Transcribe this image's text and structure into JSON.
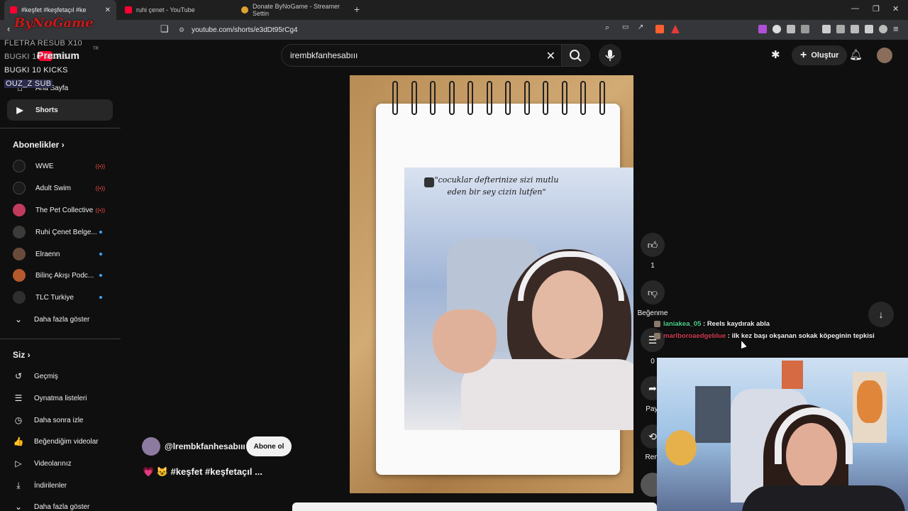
{
  "browser": {
    "tabs": [
      {
        "label": "#keşfet #keşfetaçıl #ke",
        "active": true
      },
      {
        "label": "ruhi çenet - YouTube",
        "active": false
      },
      {
        "label": "Donate ByNoGame - Streamer Settin",
        "active": false
      }
    ],
    "url": "youtube.com/shorts/e3dDt95rCg4"
  },
  "stream_overlay": {
    "logo": "ByNoGame",
    "lines": [
      "FLETRA  RESUB X10",
      "BUGKI  10 KICKS",
      "BUGKI  10 KICKS",
      "OUZ_Z  SUB"
    ]
  },
  "youtube": {
    "brand": "Premium",
    "region": "TR",
    "search_value": "irembkfanhesabııı",
    "create_label": "Oluştur"
  },
  "sidebar": {
    "items_top": [
      {
        "label": "Ana Sayfa",
        "icon": "home-icon"
      },
      {
        "label": "Shorts",
        "icon": "shorts-icon",
        "active": true
      }
    ],
    "subs_header": "Abonelikler",
    "channels": [
      {
        "label": "WWE",
        "color": "#1a1a1a",
        "live": true
      },
      {
        "label": "Adult Swim",
        "color": "#1a1a1a",
        "live": true
      },
      {
        "label": "The Pet Collective",
        "color": "#c23b5e",
        "live": true
      },
      {
        "label": "Ruhi Çenet Belge...",
        "color": "#3d3b39",
        "dot": true
      },
      {
        "label": "Elraenn",
        "color": "#6a4b3b",
        "dot": true
      },
      {
        "label": "Bilinç Akışı Podc...",
        "color": "#b45a2c",
        "dot": true
      },
      {
        "label": "TLC Turkiye",
        "color": "#2f2f2f",
        "dot": true
      }
    ],
    "show_more": "Daha fazla göster",
    "you_header": "Siz",
    "you_items": [
      {
        "label": "Geçmiş",
        "icon": "history-icon"
      },
      {
        "label": "Oynatma listeleri",
        "icon": "playlist-icon"
      },
      {
        "label": "Daha sonra izle",
        "icon": "clock-icon"
      },
      {
        "label": "Beğendiğim videolar",
        "icon": "like-icon"
      },
      {
        "label": "Videolarınız",
        "icon": "video-icon"
      },
      {
        "label": "İndirilenler",
        "icon": "download-icon"
      },
      {
        "label": "Daha fazla göster",
        "icon": "chevron-down-icon"
      }
    ]
  },
  "short": {
    "caption_text": "\"cocuklar defterinize sizi mutlu\neden bir sey cizin lutfen\"",
    "channel": "@lrembkfanhesabııı",
    "subscribe_label": "Abone ol",
    "title": "💗 😺 #keşfet #keşfetaçıl ...",
    "likes": "1",
    "dislike_label": "Beğenme",
    "comments": "0",
    "share_label": "Payl",
    "remix_label": "Rem"
  },
  "chat": [
    {
      "user": "laniakea_05",
      "text": "Reels kaydırak abla",
      "color": "#4fd18a"
    },
    {
      "user": "marlboroaedgeblue",
      "text": "ilk kez başı okşanan sokak köpeginin tepkisi",
      "color": "#d23c53"
    }
  ]
}
